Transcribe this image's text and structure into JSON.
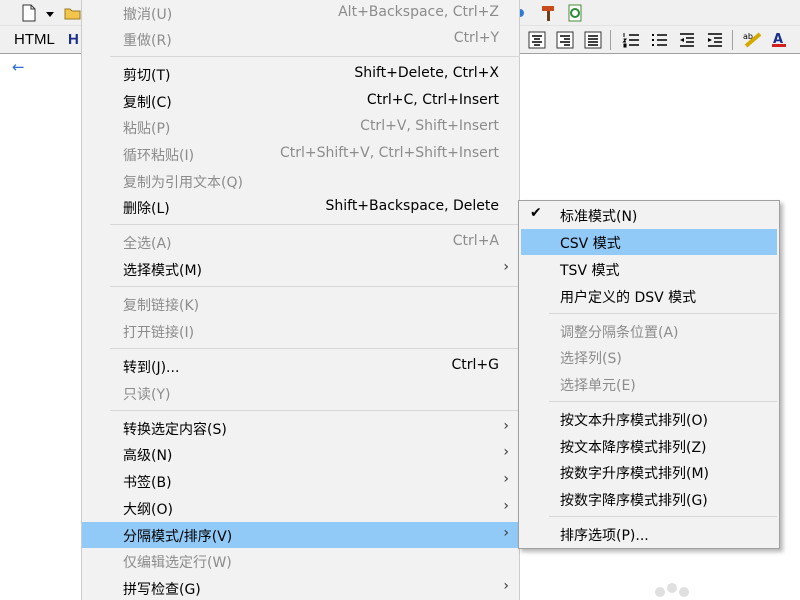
{
  "toolbar": {
    "html_label": "HTML",
    "h_label": "H"
  },
  "menu": {
    "items": [
      {
        "label": "撤消(U)",
        "shortcut": "Alt+Backspace, Ctrl+Z"
      },
      {
        "label": "重做(R)",
        "shortcut": "Ctrl+Y"
      },
      {
        "label": "剪切(T)",
        "shortcut": "Shift+Delete, Ctrl+X"
      },
      {
        "label": "复制(C)",
        "shortcut": "Ctrl+C, Ctrl+Insert"
      },
      {
        "label": "粘贴(P)",
        "shortcut": "Ctrl+V, Shift+Insert"
      },
      {
        "label": "循环粘贴(I)",
        "shortcut": "Ctrl+Shift+V, Ctrl+Shift+Insert"
      },
      {
        "label": "复制为引用文本(Q)"
      },
      {
        "label": "删除(L)",
        "shortcut": "Shift+Backspace, Delete"
      },
      {
        "label": "全选(A)",
        "shortcut": "Ctrl+A"
      },
      {
        "label": "选择模式(M)"
      },
      {
        "label": "复制链接(K)"
      },
      {
        "label": "打开链接(I)"
      },
      {
        "label": "转到(J)...",
        "shortcut": "Ctrl+G"
      },
      {
        "label": "只读(Y)"
      },
      {
        "label": "转换选定内容(S)"
      },
      {
        "label": "高级(N)"
      },
      {
        "label": "书签(B)"
      },
      {
        "label": "大纲(O)"
      },
      {
        "label": "分隔模式/排序(V)"
      },
      {
        "label": "仅编辑选定行(W)"
      },
      {
        "label": "拼写检查(G)"
      }
    ]
  },
  "submenu": {
    "items": [
      {
        "label": "标准模式(N)",
        "checked": true
      },
      {
        "label": "CSV 模式"
      },
      {
        "label": "TSV 模式"
      },
      {
        "label": "用户定义的 DSV 模式"
      },
      {
        "label": "调整分隔条位置(A)"
      },
      {
        "label": "选择列(S)"
      },
      {
        "label": "选择单元(E)"
      },
      {
        "label": "按文本升序模式排列(O)"
      },
      {
        "label": "按文本降序模式排列(Z)"
      },
      {
        "label": "按数字升序模式排列(M)"
      },
      {
        "label": "按数字降序模式排列(G)"
      },
      {
        "label": "排序选项(P)..."
      }
    ]
  },
  "colors": {
    "highlight": "#91c9f7",
    "menu_bg": "#f2f2f2",
    "disabled_text": "#8c8c8c"
  }
}
